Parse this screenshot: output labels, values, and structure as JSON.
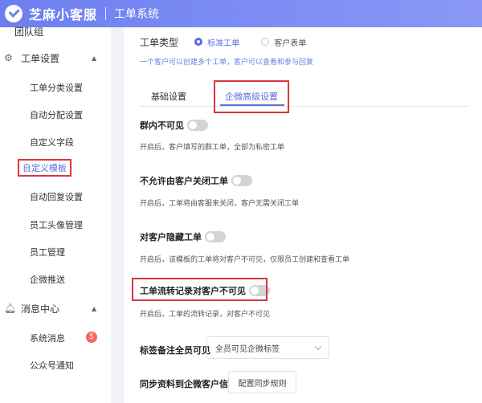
{
  "header": {
    "brand": "芝麻小客服",
    "system": "工单系统"
  },
  "sidebar": {
    "hidden_item": "团队组",
    "hidden_item_extra": "nl",
    "group_ticket": {
      "label": "工单设置",
      "icon": "gear-icon",
      "items": [
        {
          "label": "工单分类设置"
        },
        {
          "label": "自动分配设置"
        },
        {
          "label": "自定义字段"
        },
        {
          "label": "自定义模板"
        },
        {
          "label": "自动回复设置"
        },
        {
          "label": "员工头像管理"
        },
        {
          "label": "员工管理"
        },
        {
          "label": "企微推送"
        }
      ]
    },
    "group_msg": {
      "label": "消息中心",
      "icon": "bell-icon",
      "items": [
        {
          "label": "系统消息",
          "badge": "5"
        },
        {
          "label": "公众号通知"
        }
      ]
    }
  },
  "main": {
    "type_label": "工单类型",
    "radio_standard": "标准工单",
    "radio_customer": "客户表单",
    "type_hint": "一个客户可以创建多个工单，客户可以查看和参与回复",
    "tabs": [
      {
        "label": "基础设置"
      },
      {
        "label": "企微高级设置"
      }
    ],
    "settings": [
      {
        "title": "群内不可见",
        "desc": "开启后，客户填写的群工单，全部为私密工单"
      },
      {
        "title": "不允许由客户关闭工单",
        "desc": "开启后，工单将由客服来关闭，客户无需关闭工单"
      },
      {
        "title": "对客户隐藏工单",
        "desc": "开启后，该模板的工单将对客户不可见，仅限员工创建和查看工单"
      },
      {
        "title": "工单流转记录对客户不可见",
        "desc": "开启后，工单的流转记录，对客户不可见"
      }
    ],
    "tag_label": "标签备注全员可见",
    "tag_select": "全员可见企微标签",
    "sync_label": "同步资料到企微客户信息",
    "sync_button": "配置同步规则"
  },
  "colors": {
    "accent": "#5b6bdc",
    "header": "#7b8cf4",
    "highlight_box": "#d9363e",
    "badge": "#f5685d"
  }
}
